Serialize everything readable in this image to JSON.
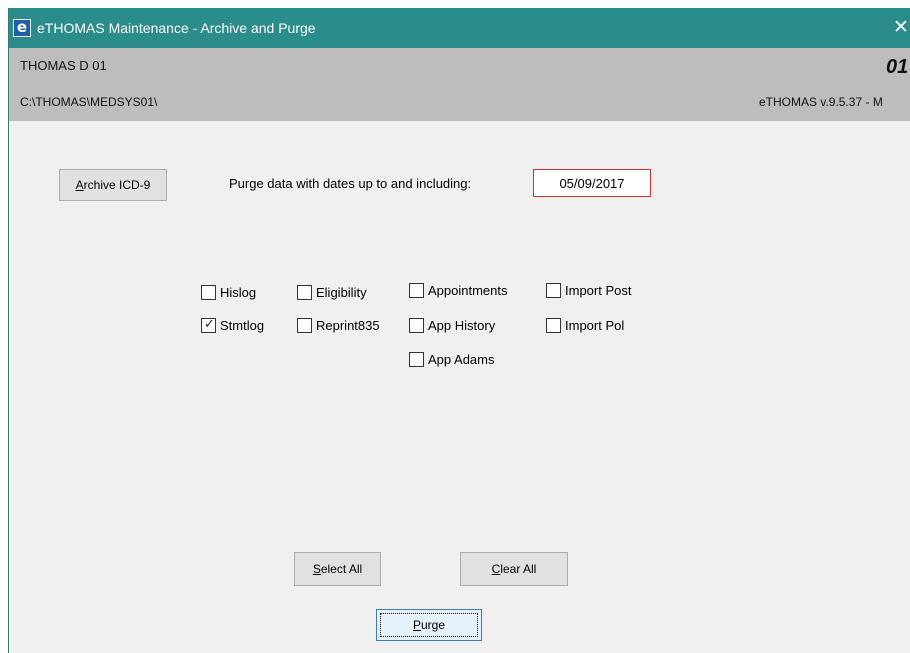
{
  "window": {
    "title": "eTHOMAS Maintenance - Archive and Purge",
    "app_icon_glyph": "e",
    "close_glyph": "✕",
    "colors": {
      "titlebar": "#2b8c8c",
      "infobar": "#bdbdbd",
      "body": "#f0f0f0",
      "date_border": "#d43030"
    }
  },
  "info": {
    "site_name": "THOMAS D 01",
    "site_path": "C:\\THOMAS\\MEDSYS01\\",
    "site_code": "01",
    "version": "eTHOMAS v.9.5.37 - M"
  },
  "archive_button": {
    "accesskey": "A",
    "rest": "rchive ICD-9"
  },
  "purge_prompt": "Purge data with dates up to and including:",
  "purge_date": "05/09/2017",
  "checkboxes": [
    {
      "label": "Hislog",
      "checked": false
    },
    {
      "label": "Eligibility",
      "checked": false
    },
    {
      "label": "Appointments",
      "checked": false
    },
    {
      "label": "Import Post",
      "checked": false
    },
    {
      "label": "Stmtlog",
      "checked": true
    },
    {
      "label": "Reprint835",
      "checked": false
    },
    {
      "label": "App History",
      "checked": false
    },
    {
      "label": "Import Pol",
      "checked": false
    },
    {
      "label": "App Adams",
      "checked": false
    }
  ],
  "buttons": {
    "select_all": {
      "accesskey": "S",
      "rest": "elect All"
    },
    "clear_all": {
      "accesskey": "C",
      "rest": "lear All"
    },
    "purge": {
      "accesskey": "P",
      "rest": "urge"
    }
  }
}
